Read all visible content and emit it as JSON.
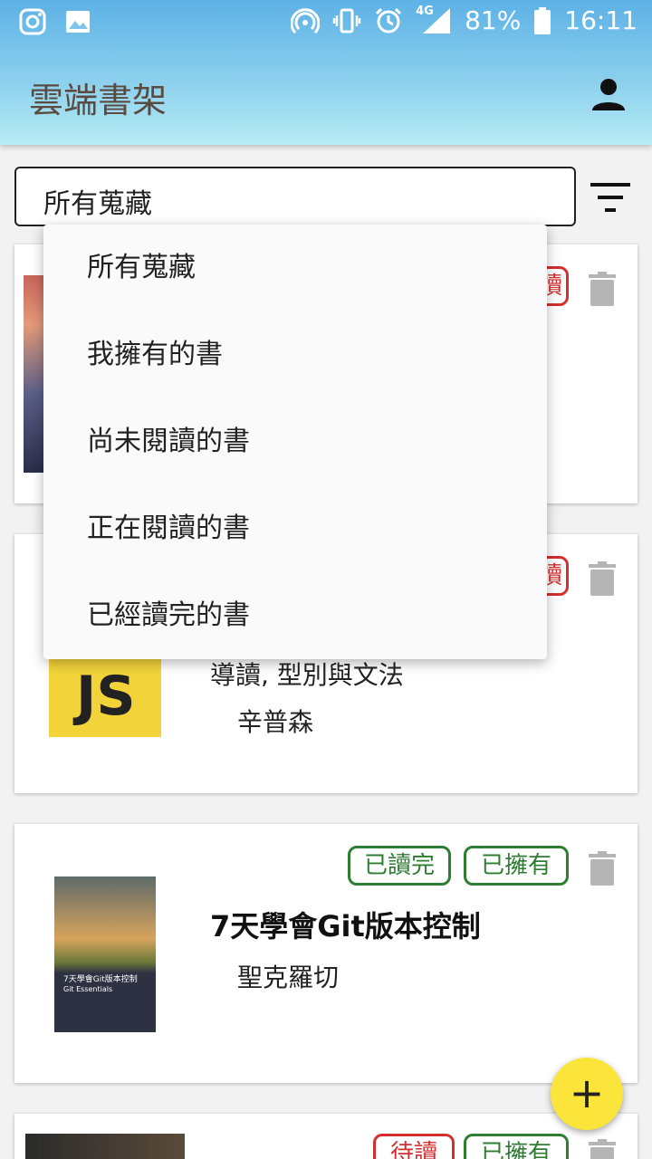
{
  "status_bar": {
    "battery": "81%",
    "time": "16:11",
    "network": "4G"
  },
  "app": {
    "title": "雲端書架"
  },
  "filter": {
    "selected": "所有蒐藏",
    "options": [
      "所有蒐藏",
      "我擁有的書",
      "尚未閱讀的書",
      "正在閱讀的書",
      "已經讀完的書"
    ]
  },
  "books": [
    {
      "subtitle": "",
      "author": "",
      "tags": [
        "讀"
      ]
    },
    {
      "subtitle": "導讀, 型別與文法",
      "author": "辛普森",
      "tags": [
        "讀"
      ],
      "cover_text": "JS"
    },
    {
      "title": "7天學會Git版本控制",
      "author": "聖克羅切",
      "tags": [
        "已讀完",
        "已擁有"
      ],
      "cover_title": "7天學會Git版本控制",
      "cover_sub": "Git Essentials"
    },
    {
      "tags": [
        "待讀",
        "已擁有"
      ]
    }
  ],
  "colors": {
    "accent_green": "#2e7d32",
    "accent_red": "#d32f2f",
    "fab": "#fbe53a"
  },
  "icons": [
    "instagram-icon",
    "image-icon",
    "hotspot-icon",
    "vibrate-icon",
    "alarm-icon",
    "signal-icon",
    "battery-icon",
    "account-icon",
    "filter-icon",
    "trash-icon",
    "add-icon"
  ]
}
